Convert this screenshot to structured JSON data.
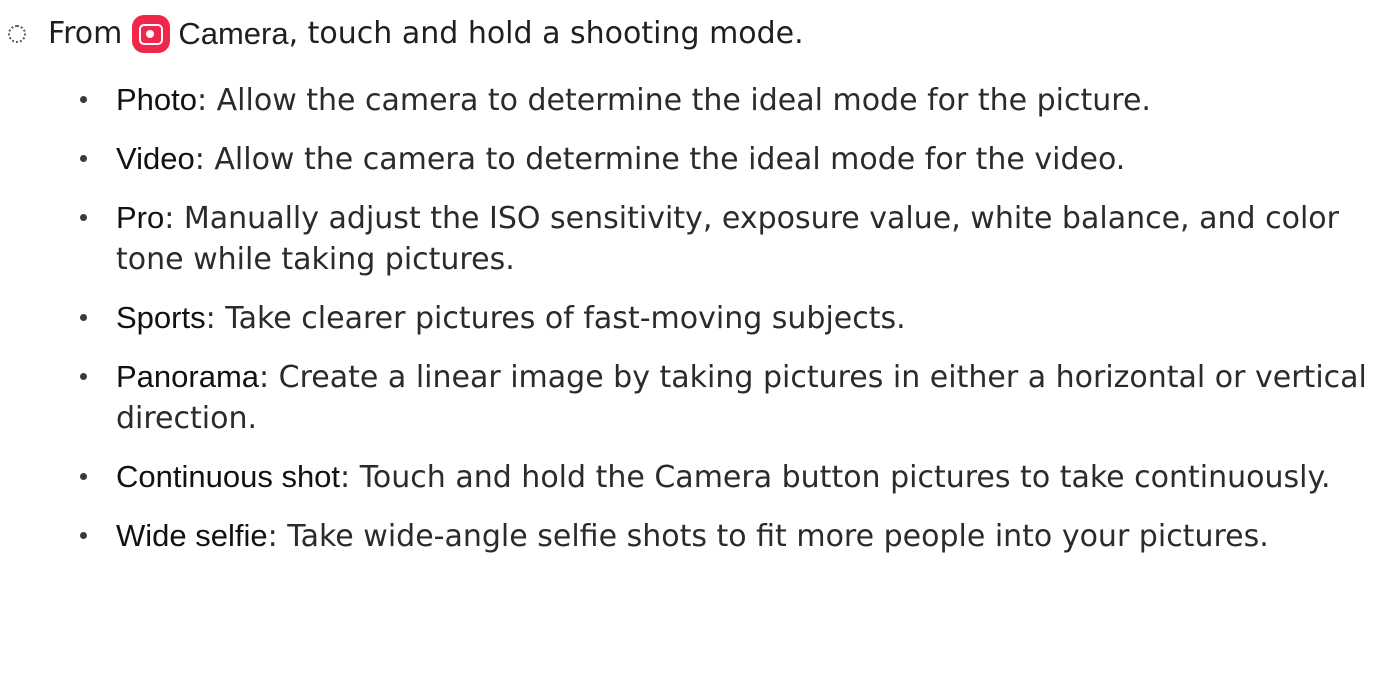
{
  "step": {
    "prefix": "From",
    "app_name": "Camera",
    "suffix": ", touch and hold a shooting mode.",
    "app_icon": "camera-app-icon",
    "app_icon_color": "#f2264b"
  },
  "modes": [
    {
      "name": "Photo",
      "description": ": Allow the camera to determine the ideal mode for the picture."
    },
    {
      "name": "Video",
      "description": ": Allow the camera to determine the ideal mode for the video."
    },
    {
      "name": "Pro",
      "description": ": Manually adjust the ISO sensitivity, exposure value, white balance, and color tone while taking pictures."
    },
    {
      "name": "Sports",
      "description": ": Take clearer pictures of fast-moving subjects."
    },
    {
      "name": "Panorama",
      "description": ": Create a linear image by taking pictures in either a horizontal or vertical direction."
    },
    {
      "name": "Continuous shot",
      "description": ": Touch and hold the Camera button pictures to take continuously."
    },
    {
      "name": "Wide selfie",
      "description": ": Take wide-angle selfie shots to fit more people into your pictures."
    }
  ]
}
